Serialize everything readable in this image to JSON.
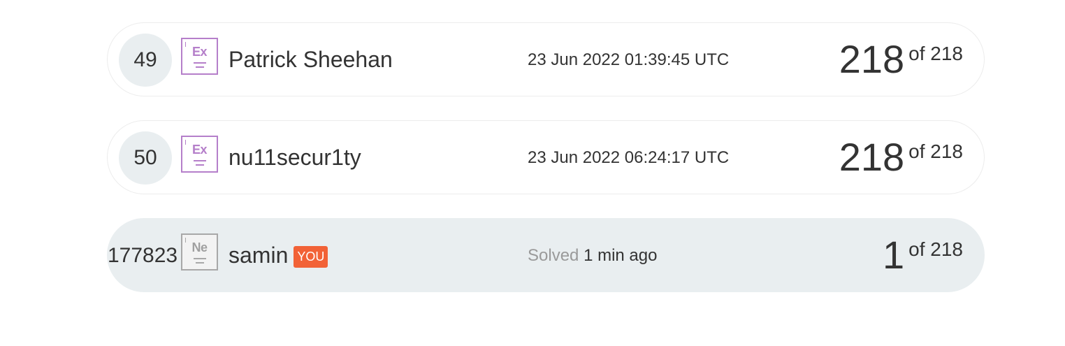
{
  "colors": {
    "row_border": "#ececec",
    "highlight_bg": "#e9eef0",
    "badge_purple": "#b57fca",
    "badge_gray": "#a8a8a8",
    "you_badge": "#f26237",
    "muted_text": "#9a9a9a"
  },
  "rows": [
    {
      "rank": "49",
      "badge_symbol": "Ex",
      "name": "Patrick Sheehan",
      "time": "23 Jun 2022 01:39:45 UTC",
      "score": "218",
      "of_label": "of 218"
    },
    {
      "rank": "50",
      "badge_symbol": "Ex",
      "name": "nu11secur1ty",
      "time": "23 Jun 2022 06:24:17 UTC",
      "score": "218",
      "of_label": "of 218"
    }
  ],
  "me": {
    "rank": "177823",
    "badge_symbol": "Ne",
    "name": "samin",
    "you_label": "YOU",
    "solved_label": "Solved",
    "time": "1 min ago",
    "score": "1",
    "of_label": "of 218"
  }
}
